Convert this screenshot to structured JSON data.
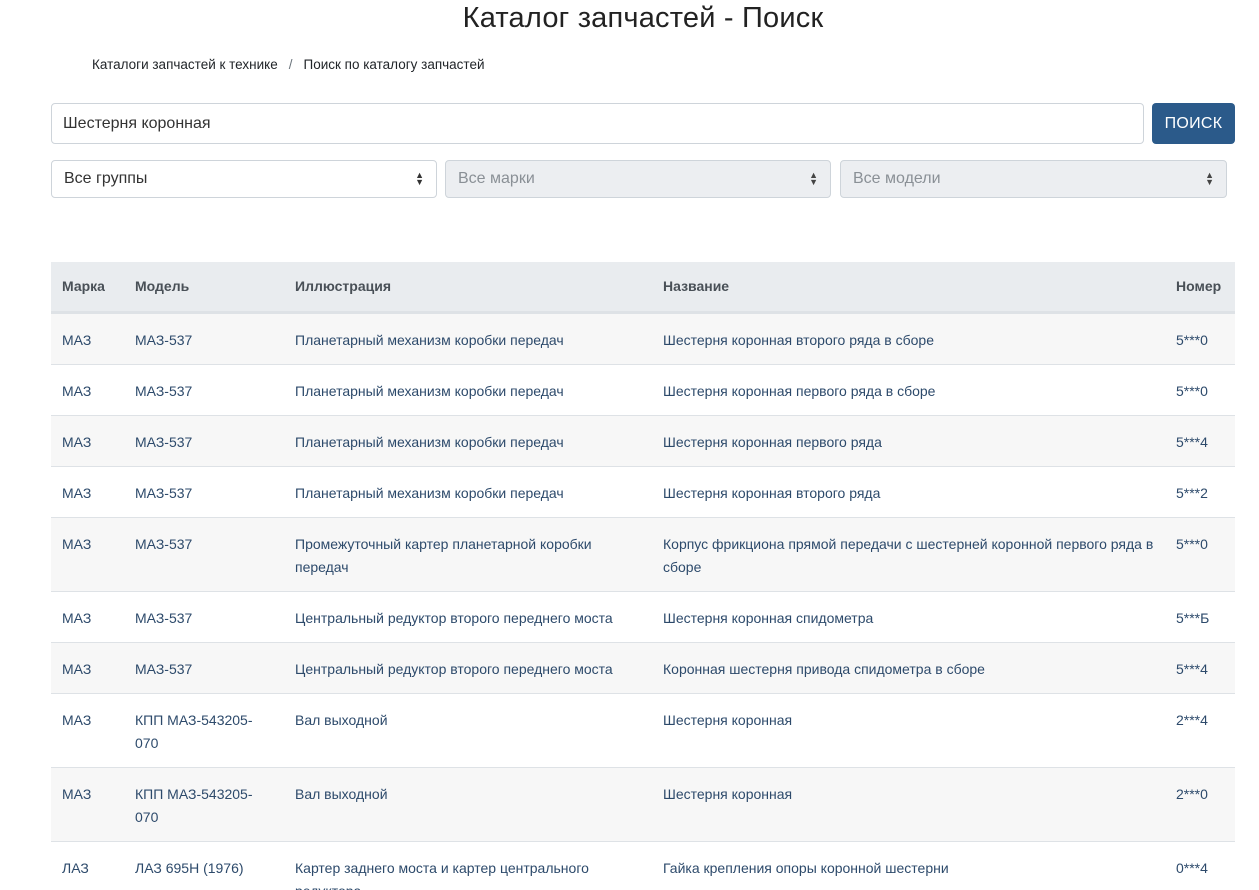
{
  "page": {
    "title": "Каталог запчастей - Поиск"
  },
  "breadcrumb": {
    "items": [
      "Каталоги запчастей к технике",
      "Поиск по каталогу запчастей"
    ],
    "separator": "/"
  },
  "search": {
    "value": "Шестерня коронная",
    "button_label": "ПОИСК"
  },
  "filters": {
    "groups": "Все группы",
    "brands": "Все марки",
    "models": "Все модели"
  },
  "table": {
    "headers": [
      "Марка",
      "Модель",
      "Иллюстрация",
      "Название",
      "Номер"
    ],
    "rows": [
      [
        "МАЗ",
        "МАЗ-537",
        "Планетарный механизм коробки передач",
        "Шестерня коронная второго ряда в сборе",
        "5***0"
      ],
      [
        "МАЗ",
        "МАЗ-537",
        "Планетарный механизм коробки передач",
        "Шестерня коронная первого ряда в сборе",
        "5***0"
      ],
      [
        "МАЗ",
        "МАЗ-537",
        "Планетарный механизм коробки передач",
        "Шестерня коронная первого ряда",
        "5***4"
      ],
      [
        "МАЗ",
        "МАЗ-537",
        "Планетарный механизм коробки передач",
        "Шестерня коронная второго ряда",
        "5***2"
      ],
      [
        "МАЗ",
        "МАЗ-537",
        "Промежуточный картер планетарной коробки передач",
        "Корпус фрикциона прямой передачи с шестерней коронной первого ряда в сборе",
        "5***0"
      ],
      [
        "МАЗ",
        "МАЗ-537",
        "Центральный редуктор второго переднего моста",
        "Шестерня коронная спидометра",
        "5***Б"
      ],
      [
        "МАЗ",
        "МАЗ-537",
        "Центральный редуктор второго переднего моста",
        "Коронная шестерня привода спидометра в сборе",
        "5***4"
      ],
      [
        "МАЗ",
        "КПП МАЗ-543205-070",
        "Вал выходной",
        "Шестерня коронная",
        "2***4"
      ],
      [
        "МАЗ",
        "КПП МАЗ-543205-070",
        "Вал выходной",
        "Шестерня коронная",
        "2***0"
      ],
      [
        "ЛАЗ",
        "ЛАЗ 695Н (1976)",
        "Картер заднего моста и картер центрального редуктора",
        "Гайка крепления опоры коронной шестерни",
        "0***4"
      ]
    ]
  },
  "colors": {
    "button": "#2b5a8a",
    "link": "#2d4a6b",
    "header_bg": "#e9ecef"
  }
}
